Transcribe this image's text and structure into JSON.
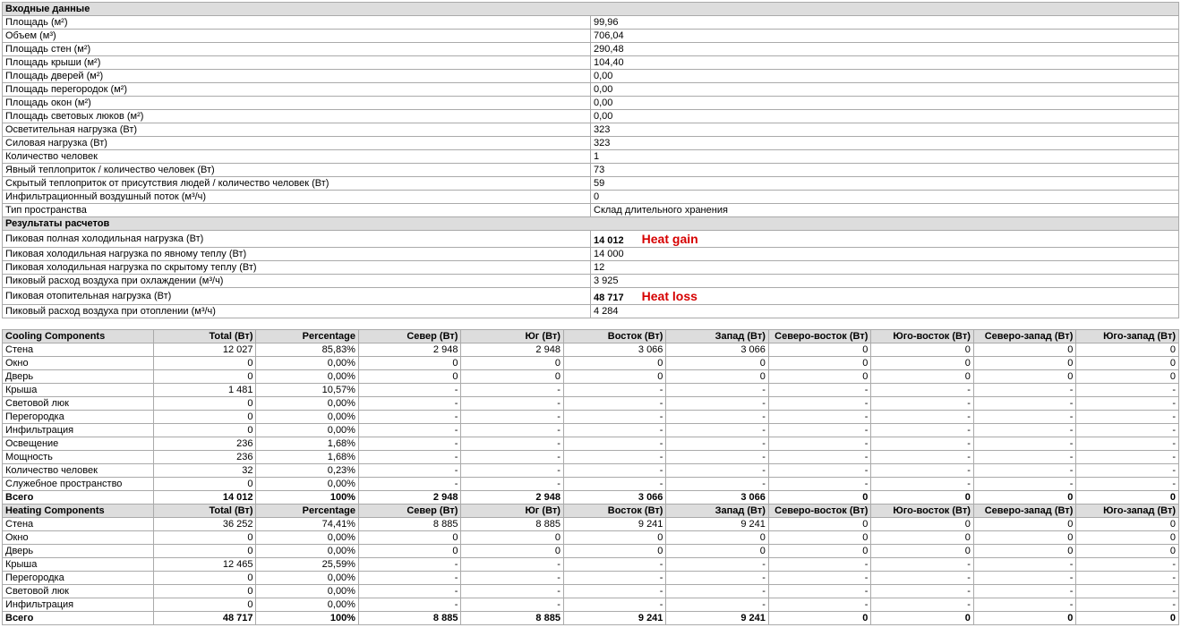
{
  "input": {
    "header": "Входные данные",
    "rows": [
      {
        "label": "Площадь (м²)",
        "value": "99,96"
      },
      {
        "label": "Объем (м³)",
        "value": "706,04"
      },
      {
        "label": "Площадь стен (м²)",
        "value": "290,48"
      },
      {
        "label": "Площадь крыши (м²)",
        "value": "104,40"
      },
      {
        "label": "Площадь дверей (м²)",
        "value": "0,00"
      },
      {
        "label": "Площадь перегородок (м²)",
        "value": "0,00"
      },
      {
        "label": "Площадь окон (м²)",
        "value": "0,00"
      },
      {
        "label": "Площадь световых люков (м²)",
        "value": "0,00"
      },
      {
        "label": "Осветительная нагрузка (Вт)",
        "value": "323"
      },
      {
        "label": "Силовая нагрузка (Вт)",
        "value": "323"
      },
      {
        "label": "Количество человек",
        "value": "1"
      },
      {
        "label": "Явный теплоприток / количество человек (Вт)",
        "value": "73"
      },
      {
        "label": "Скрытый теплоприток от присутствия людей / количество человек (Вт)",
        "value": "59"
      },
      {
        "label": "Инфильтрационный воздушный поток (м³/ч)",
        "value": "0"
      },
      {
        "label": "Тип пространства",
        "value": "Склад длительного хранения"
      }
    ]
  },
  "results": {
    "header": "Результаты расчетов",
    "rows": [
      {
        "label": "Пиковая полная холодильная нагрузка (Вт)",
        "value": "14 012",
        "bold": true,
        "annot": "Heat gain"
      },
      {
        "label": "Пиковая холодильная нагрузка по явному теплу (Вт)",
        "value": "14 000"
      },
      {
        "label": "Пиковая холодильная нагрузка по скрытому теплу (Вт)",
        "value": "12"
      },
      {
        "label": "Пиковый расход воздуха при охлаждении (м³/ч)",
        "value": "3 925"
      },
      {
        "label": "Пиковая отопительная нагрузка (Вт)",
        "value": "48 717",
        "bold": true,
        "annot": "Heat loss"
      },
      {
        "label": "Пиковый расход воздуха при отоплении (м³/ч)",
        "value": "4 284"
      }
    ]
  },
  "cooling": {
    "header": [
      "Cooling Components",
      "Total (Вт)",
      "Percentage",
      "Север (Вт)",
      "Юг (Вт)",
      "Восток (Вт)",
      "Запад (Вт)",
      "Северо-восток (Вт)",
      "Юго-восток (Вт)",
      "Северо-запад (Вт)",
      "Юго-запад (Вт)"
    ],
    "rows": [
      [
        "Стена",
        "12 027",
        "85,83%",
        "2 948",
        "2 948",
        "3 066",
        "3 066",
        "0",
        "0",
        "0",
        "0"
      ],
      [
        "Окно",
        "0",
        "0,00%",
        "0",
        "0",
        "0",
        "0",
        "0",
        "0",
        "0",
        "0"
      ],
      [
        "Дверь",
        "0",
        "0,00%",
        "0",
        "0",
        "0",
        "0",
        "0",
        "0",
        "0",
        "0"
      ],
      [
        "Крыша",
        "1 481",
        "10,57%",
        "-",
        "-",
        "-",
        "-",
        "-",
        "-",
        "-",
        "-"
      ],
      [
        "Световой люк",
        "0",
        "0,00%",
        "-",
        "-",
        "-",
        "-",
        "-",
        "-",
        "-",
        "-"
      ],
      [
        "Перегородка",
        "0",
        "0,00%",
        "-",
        "-",
        "-",
        "-",
        "-",
        "-",
        "-",
        "-"
      ],
      [
        "Инфильтрация",
        "0",
        "0,00%",
        "-",
        "-",
        "-",
        "-",
        "-",
        "-",
        "-",
        "-"
      ],
      [
        "Освещение",
        "236",
        "1,68%",
        "-",
        "-",
        "-",
        "-",
        "-",
        "-",
        "-",
        "-"
      ],
      [
        "Мощность",
        "236",
        "1,68%",
        "-",
        "-",
        "-",
        "-",
        "-",
        "-",
        "-",
        "-"
      ],
      [
        "Количество человек",
        "32",
        "0,23%",
        "-",
        "-",
        "-",
        "-",
        "-",
        "-",
        "-",
        "-"
      ],
      [
        "Служебное пространство",
        "0",
        "0,00%",
        "-",
        "-",
        "-",
        "-",
        "-",
        "-",
        "-",
        "-"
      ]
    ],
    "totals": [
      "Всего",
      "14 012",
      "100%",
      "2 948",
      "2 948",
      "3 066",
      "3 066",
      "0",
      "0",
      "0",
      "0"
    ]
  },
  "heating": {
    "header": [
      "Heating Components",
      "Total (Вт)",
      "Percentage",
      "Север (Вт)",
      "Юг (Вт)",
      "Восток (Вт)",
      "Запад (Вт)",
      "Северо-восток (Вт)",
      "Юго-восток (Вт)",
      "Северо-запад (Вт)",
      "Юго-запад (Вт)"
    ],
    "rows": [
      [
        "Стена",
        "36 252",
        "74,41%",
        "8 885",
        "8 885",
        "9 241",
        "9 241",
        "0",
        "0",
        "0",
        "0"
      ],
      [
        "Окно",
        "0",
        "0,00%",
        "0",
        "0",
        "0",
        "0",
        "0",
        "0",
        "0",
        "0"
      ],
      [
        "Дверь",
        "0",
        "0,00%",
        "0",
        "0",
        "0",
        "0",
        "0",
        "0",
        "0",
        "0"
      ],
      [
        "Крыша",
        "12 465",
        "25,59%",
        "-",
        "-",
        "-",
        "-",
        "-",
        "-",
        "-",
        "-"
      ],
      [
        "Перегородка",
        "0",
        "0,00%",
        "-",
        "-",
        "-",
        "-",
        "-",
        "-",
        "-",
        "-"
      ],
      [
        "Световой люк",
        "0",
        "0,00%",
        "-",
        "-",
        "-",
        "-",
        "-",
        "-",
        "-",
        "-"
      ],
      [
        "Инфильтрация",
        "0",
        "0,00%",
        "-",
        "-",
        "-",
        "-",
        "-",
        "-",
        "-",
        "-"
      ]
    ],
    "totals": [
      "Всего",
      "48 717",
      "100%",
      "8 885",
      "8 885",
      "9 241",
      "9 241",
      "0",
      "0",
      "0",
      "0"
    ]
  }
}
